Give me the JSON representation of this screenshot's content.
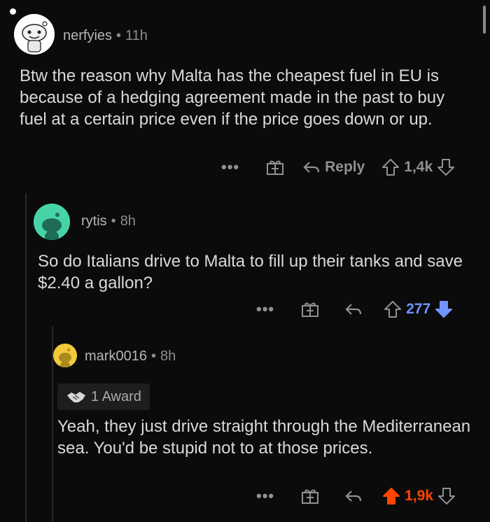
{
  "comments": [
    {
      "username": "nerfyies",
      "time": "11h",
      "body": "Btw the reason why Malta has the cheapest fuel in EU is because of a hedging agreement made in the past to buy fuel at a certain price even if the price goes down or up.",
      "reply_label": "Reply",
      "score": "1,4k",
      "vote_state": "none"
    },
    {
      "username": "rytis",
      "time": "8h",
      "body": "So do Italians drive to Malta to fill up their tanks and save $2.40 a gallon?",
      "score": "277",
      "vote_state": "downvoted",
      "vote_color": "#7193ff"
    },
    {
      "username": "mark0016",
      "time": "8h",
      "award": "1 Award",
      "body": "Yeah, they just drive straight through the Mediterranean sea. You'd be stupid not to at those prices.",
      "score": "1,9k",
      "vote_state": "upvoted",
      "vote_color": "#ff4500"
    }
  ],
  "separator": "•",
  "more_label": "•••"
}
